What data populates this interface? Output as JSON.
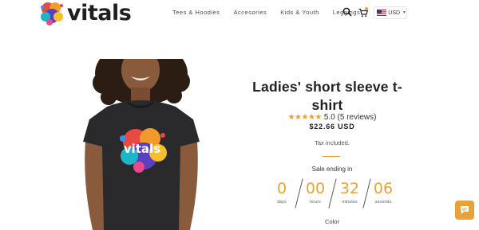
{
  "header": {
    "brand": "vitals",
    "nav": [
      "Tees & Hoodies",
      "Accesories",
      "Kids & Youth",
      "Leggings"
    ],
    "currency": "USD"
  },
  "product": {
    "title_line1": "Ladies' short sleeve t-",
    "title_line2": "shirt",
    "rating_text": "5.0 (5 reviews)",
    "stars": "★★★★★",
    "price": "$22.66 USD",
    "tax": "Tax included.",
    "sale_label": "Sale ending in",
    "shirt_logo": "vitals",
    "color_label": "Color"
  },
  "countdown": [
    {
      "value": "0",
      "label": "days"
    },
    {
      "value": "00",
      "label": "hours"
    },
    {
      "value": "32",
      "label": "minutes"
    },
    {
      "value": "06",
      "label": "seconds"
    }
  ],
  "colors": {
    "accent": "#e8a23a",
    "shirt": "#2a2a2c",
    "skin": "#8a5a3c",
    "hair": "#2b1d14"
  },
  "icons": [
    "logo-mark-icon",
    "search-icon",
    "cart-icon",
    "us-flag-icon",
    "chevron-down-icon",
    "chat-icon"
  ]
}
